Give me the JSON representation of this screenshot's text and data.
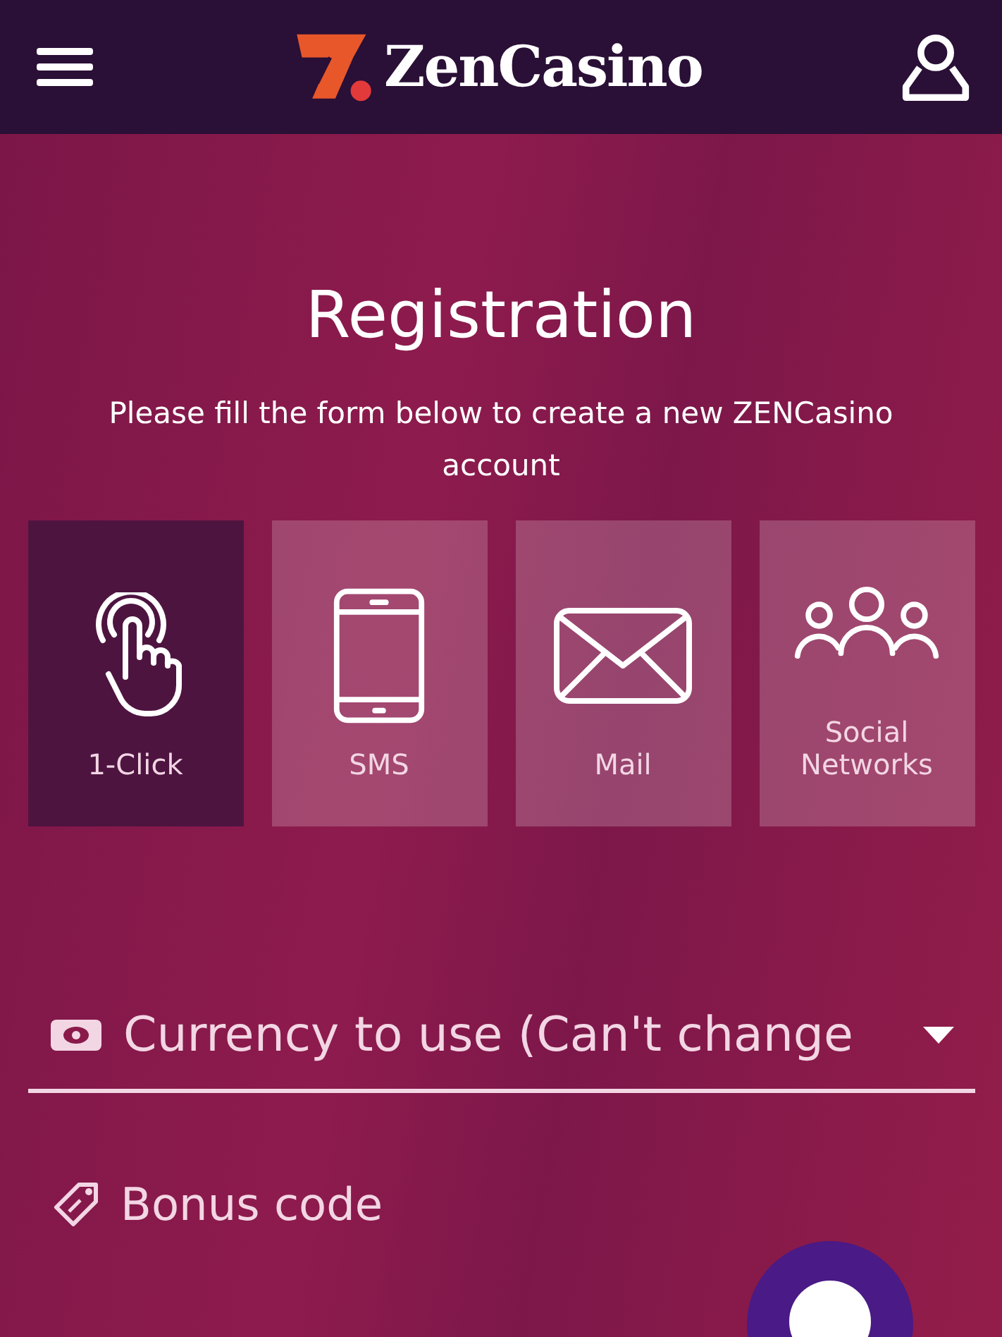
{
  "header": {
    "brand": "ZenCasino"
  },
  "title": "Registration",
  "subtitle": "Please fill the form below to create a new ZENCasino account",
  "methods": [
    {
      "label": "1-Click",
      "kind": "tap",
      "selected": true
    },
    {
      "label": "SMS",
      "kind": "phone",
      "selected": false
    },
    {
      "label": "Mail",
      "kind": "mail",
      "selected": false
    },
    {
      "label": "Social Networks",
      "kind": "people",
      "selected": false
    }
  ],
  "currency_field": {
    "value": "Currency to use (Can't change"
  },
  "bonus_field": {
    "placeholder": "Bonus code"
  }
}
